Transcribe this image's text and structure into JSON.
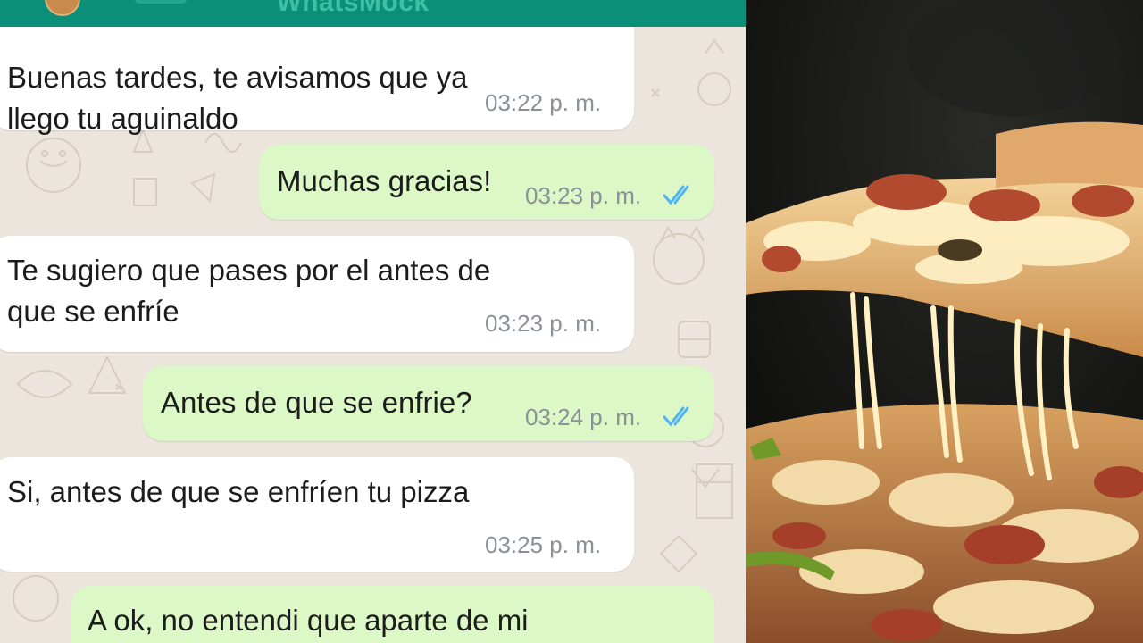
{
  "app": {
    "title": "WhatsMock"
  },
  "messages": [
    {
      "direction": "incoming",
      "text": "Buenas tardes, te avisamos que ya\nllego tu aguinaldo",
      "time": "03:22 p. m."
    },
    {
      "direction": "outgoing",
      "text": "Muchas gracias!",
      "time": "03:23 p. m.",
      "status": "read"
    },
    {
      "direction": "incoming",
      "text": "Te sugiero que pases por el antes de\nque se enfríe",
      "time": "03:23 p. m."
    },
    {
      "direction": "outgoing",
      "text": "Antes de que se enfrie?",
      "time": "03:24 p. m.",
      "status": "read"
    },
    {
      "direction": "incoming",
      "text": "Si, antes de que se enfríen tu pizza",
      "time": "03:25 p. m."
    },
    {
      "direction": "outgoing",
      "text": "A ok, no entendi que aparte de mi"
    }
  ],
  "photo": {
    "subject": "pizza-slice-cheese-pull"
  },
  "colors": {
    "header": "#0b8f78",
    "incoming": "#ffffff",
    "outgoing": "#dcf8c6",
    "read_ticks": "#4fb3f6",
    "background": "#ece5dd"
  },
  "icons": {
    "read_receipt": "double-check-icon"
  }
}
